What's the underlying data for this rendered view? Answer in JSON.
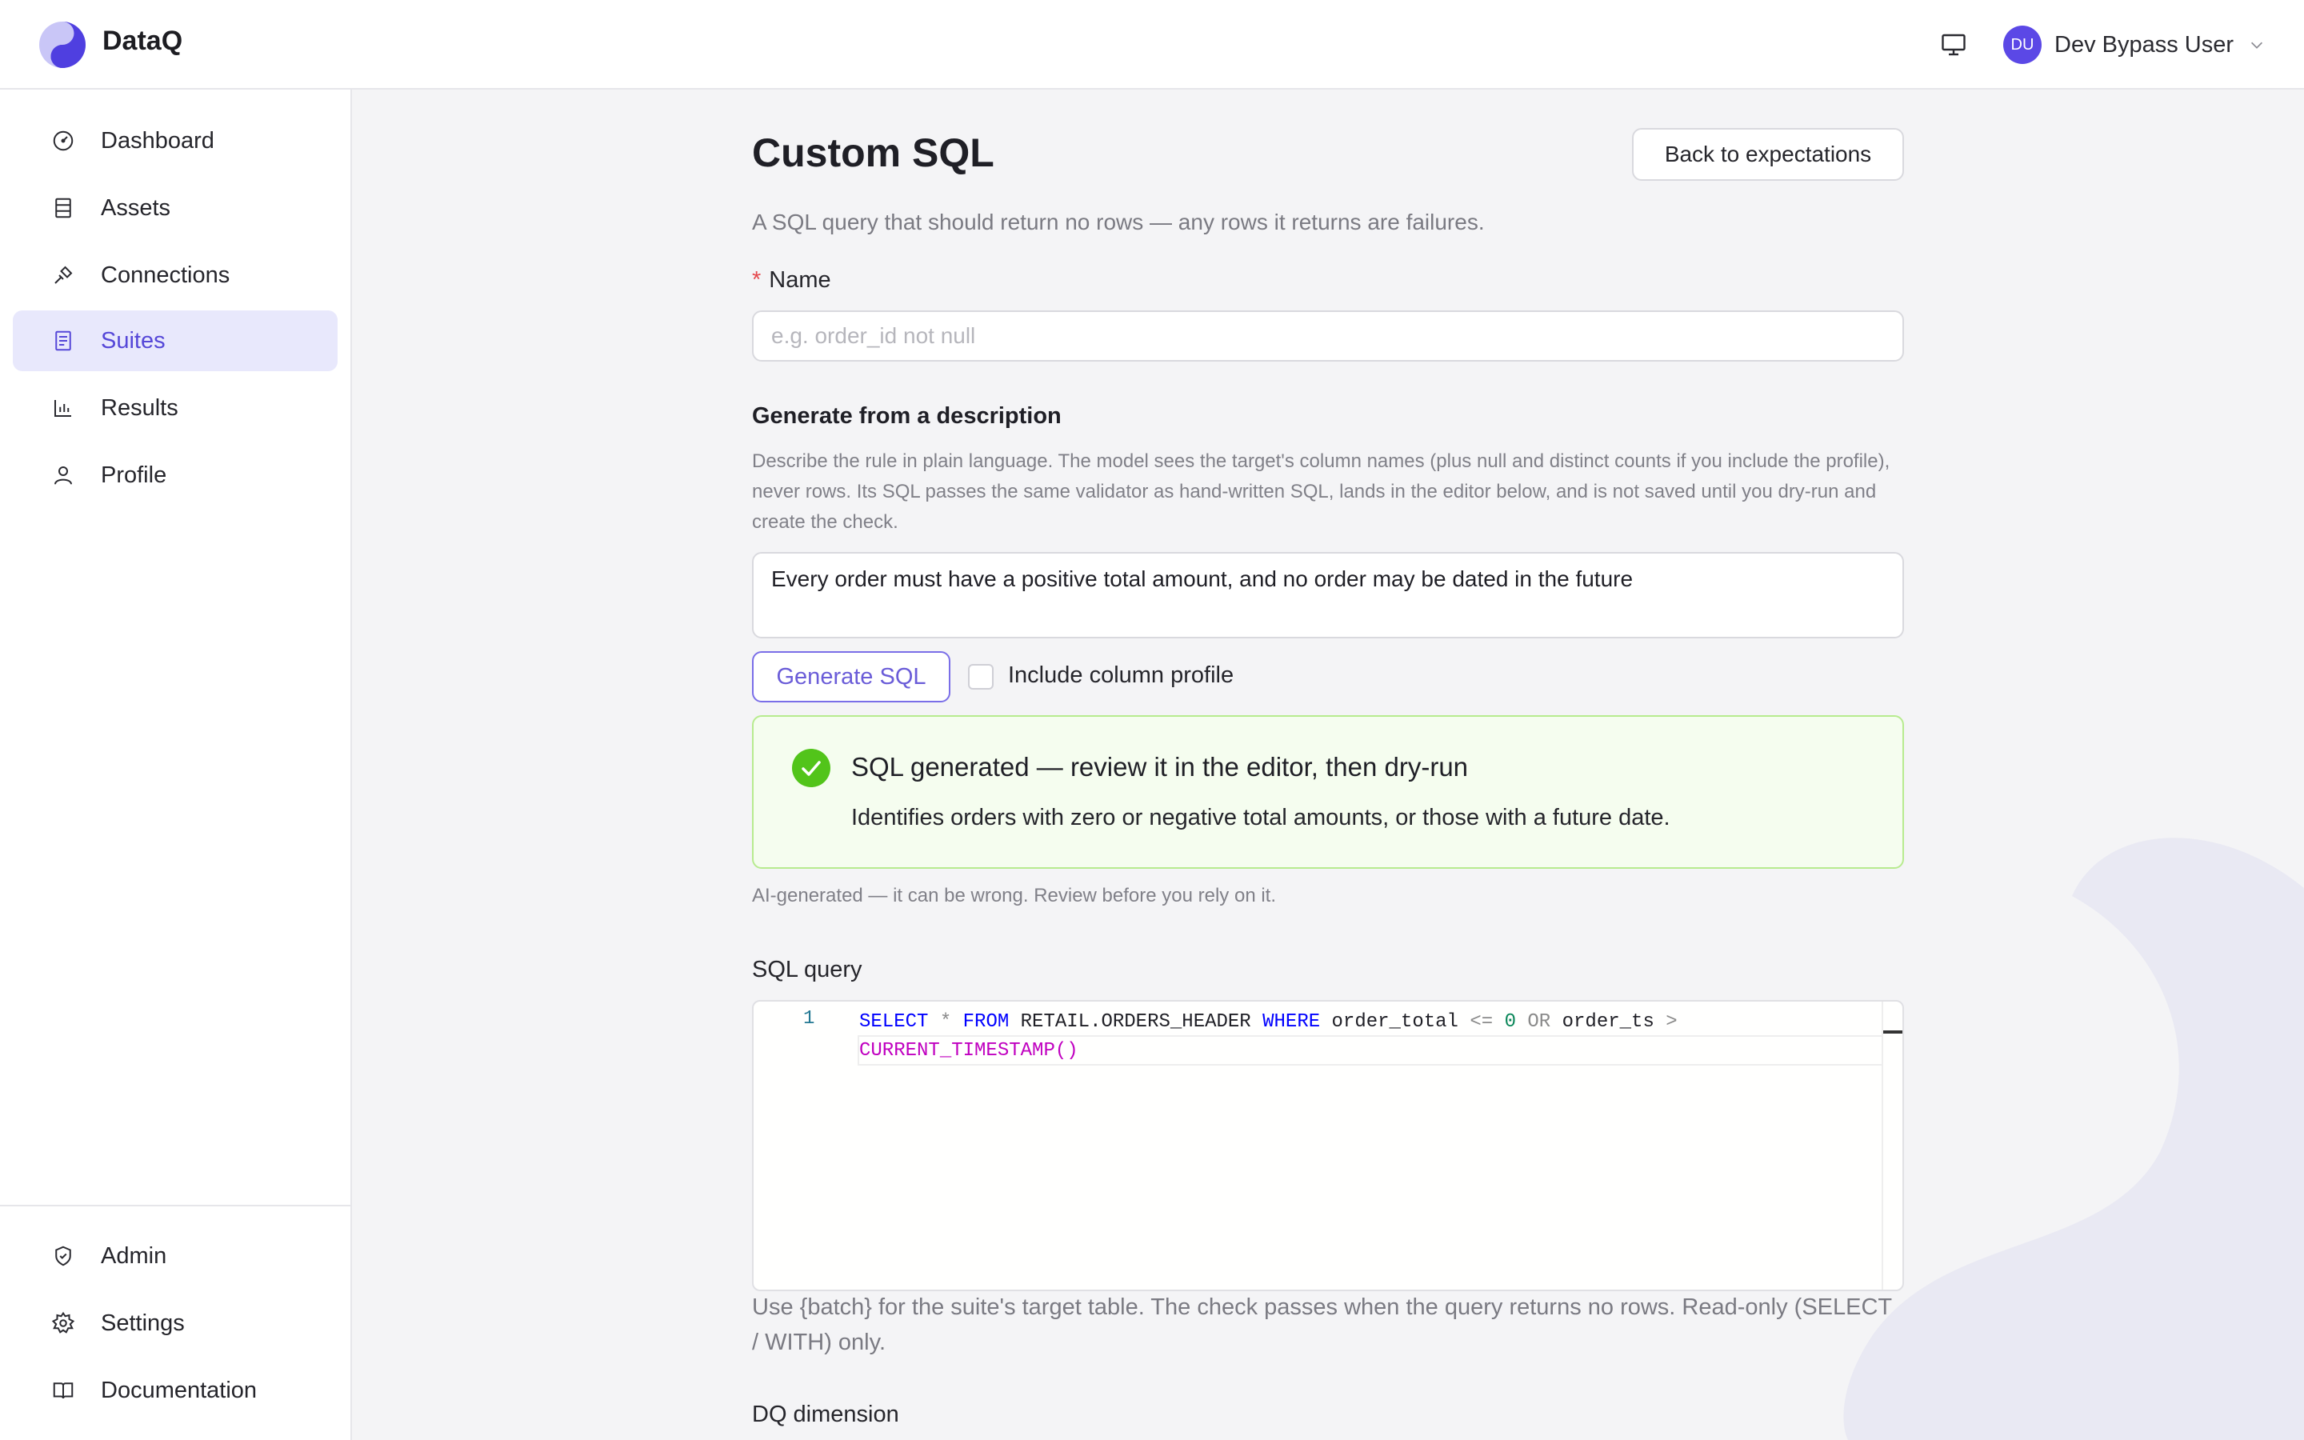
{
  "app": {
    "brand": "DataQ"
  },
  "header": {
    "user": {
      "initials": "DU",
      "name": "Dev Bypass User"
    }
  },
  "sidebar": {
    "items": [
      {
        "label": "Dashboard",
        "icon": "dashboard-icon"
      },
      {
        "label": "Assets",
        "icon": "assets-icon"
      },
      {
        "label": "Connections",
        "icon": "connections-icon"
      },
      {
        "label": "Suites",
        "icon": "suites-icon",
        "active": true
      },
      {
        "label": "Results",
        "icon": "results-icon"
      },
      {
        "label": "Profile",
        "icon": "profile-icon"
      }
    ],
    "bottom_items": [
      {
        "label": "Admin",
        "icon": "shield-icon"
      },
      {
        "label": "Settings",
        "icon": "gear-icon"
      },
      {
        "label": "Documentation",
        "icon": "book-icon"
      }
    ],
    "active_color": "#5547d8"
  },
  "page": {
    "title": "Custom SQL",
    "back_label": "Back to expectations",
    "subtitle": "A SQL query that should return no rows — any rows it returns are failures.",
    "name_label": "Name",
    "name_required_mark": "*",
    "name_placeholder": "e.g. order_id not null",
    "generate": {
      "title": "Generate from a description",
      "description": "Describe the rule in plain language. The model sees the target's column names (plus null and distinct counts if you include the profile), never rows. Its SQL passes the same validator as hand-written SQL, lands in the editor below, and is not saved until you dry-run and create the check.",
      "input_value": "Every order must have a positive total amount, and no order may be dated in the future",
      "button_label": "Generate SQL",
      "checkbox_label": "Include column profile",
      "checkbox_checked": false
    },
    "success": {
      "title": "SQL generated — review it in the editor, then dry-run",
      "description": "Identifies orders with zero or negative total amounts, or those with a future date.",
      "color": "#52c41a"
    },
    "ai_note": "AI-generated — it can be wrong. Review before you rely on it.",
    "sql": {
      "label": "SQL query",
      "line_number": "1",
      "tokens": {
        "select": "SELECT",
        "star": "*",
        "from": "FROM",
        "table": "RETAIL.ORDERS_HEADER",
        "where": "WHERE",
        "col1": "order_total",
        "le": "<=",
        "zero": "0",
        "or": "OR",
        "col2": "order_ts",
        "gt": ">",
        "func": "CURRENT_TIMESTAMP()"
      }
    },
    "help_text": "Use {batch} for the suite's target table. The check passes when the query returns no rows. Read-only (SELECT / WITH) only.",
    "dq_label": "DQ dimension"
  }
}
